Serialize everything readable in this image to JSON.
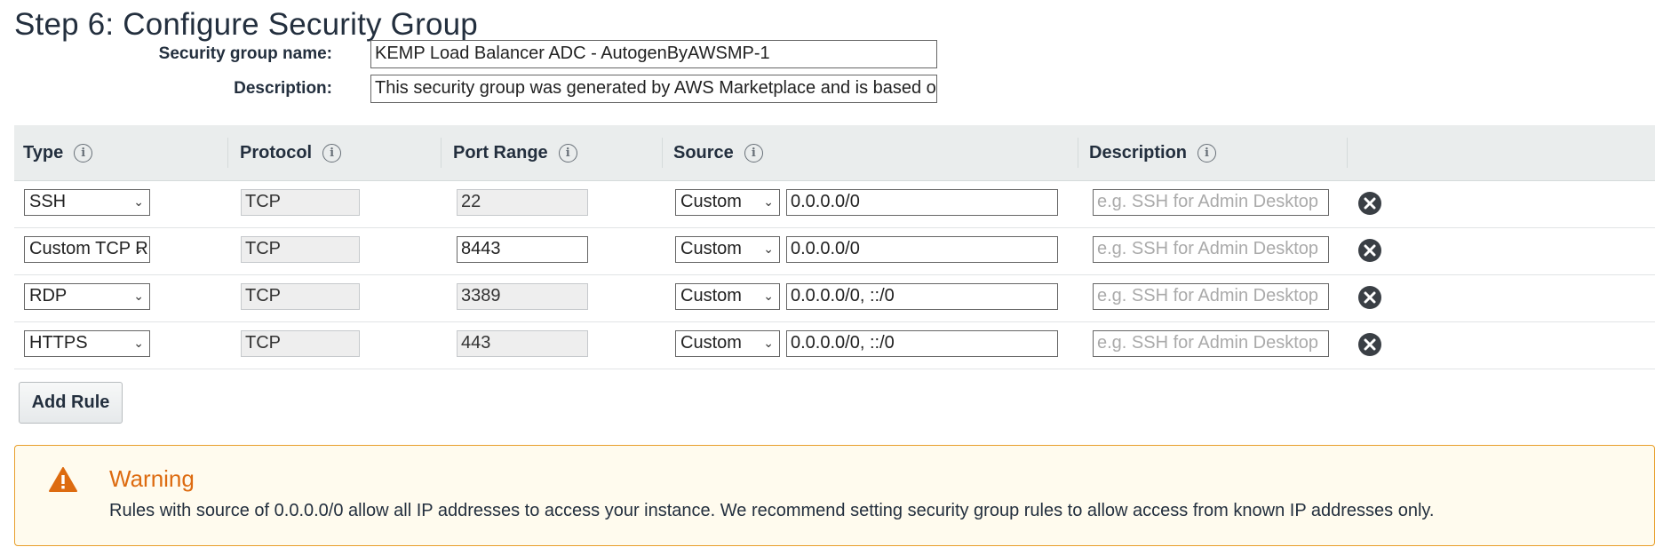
{
  "page_title": "Step 6: Configure Security Group",
  "security_group": {
    "name_label": "Security group name:",
    "name_value": "KEMP Load Balancer ADC - AutogenByAWSMP-1",
    "description_label": "Description:",
    "description_value": "This security group was generated by AWS Marketplace and is based on recomm"
  },
  "table": {
    "headers": {
      "type": "Type",
      "protocol": "Protocol",
      "port_range": "Port Range",
      "source": "Source",
      "description": "Description"
    },
    "info_glyph": "i",
    "description_placeholder": "e.g. SSH for Admin Desktop",
    "rows": [
      {
        "type": "SSH",
        "protocol": "TCP",
        "port_range": "22",
        "port_editable": false,
        "source_type": "Custom",
        "source_value": "0.0.0.0/0"
      },
      {
        "type": "Custom TCP R",
        "protocol": "TCP",
        "port_range": "8443",
        "port_editable": true,
        "source_type": "Custom",
        "source_value": "0.0.0.0/0"
      },
      {
        "type": "RDP",
        "protocol": "TCP",
        "port_range": "3389",
        "port_editable": false,
        "source_type": "Custom",
        "source_value": "0.0.0.0/0, ::/0"
      },
      {
        "type": "HTTPS",
        "protocol": "TCP",
        "port_range": "443",
        "port_editable": false,
        "source_type": "Custom",
        "source_value": "0.0.0.0/0, ::/0"
      }
    ]
  },
  "add_rule_label": "Add Rule",
  "warning": {
    "title": "Warning",
    "message": "Rules with source of 0.0.0.0/0 allow all IP addresses to access your instance. We recommend setting security group rules to allow access from known IP addresses only."
  },
  "icons": {
    "info": "info-icon",
    "dropdown": "chevron-down-icon",
    "remove": "remove-circle-icon",
    "warning": "warning-triangle-icon"
  },
  "colors": {
    "header_bg": "#eaeded",
    "warning_border": "#e89f2b",
    "warning_bg": "#fffbee",
    "warning_title": "#dd6b10",
    "remove_icon": "#3a3f45"
  }
}
